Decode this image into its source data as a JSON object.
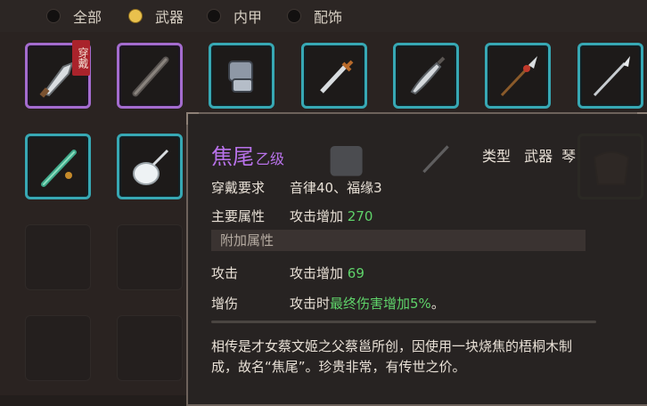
{
  "filters": [
    {
      "label": "全部",
      "selected": false
    },
    {
      "label": "武器",
      "selected": true
    },
    {
      "label": "内甲",
      "selected": false
    },
    {
      "label": "配饰",
      "selected": false
    }
  ],
  "equipped_tag": "穿戴",
  "icons": {
    "row1": [
      "broad-blade-icon",
      "iron-staff-icon",
      "gauntlet-icon",
      "short-sword-icon",
      "saber-icon",
      "tasseled-spear-icon",
      "spear-icon"
    ],
    "row2": [
      "jade-flute-icon",
      "white-brush-icon",
      "fan-icon"
    ]
  },
  "tooltip": {
    "name": "焦尾",
    "grade": "乙级",
    "type_label": "类型",
    "type_value": "武器",
    "type_sub": "琴",
    "requirement_label": "穿戴要求",
    "requirement_value": "音律40、福缘3",
    "main_attr_label": "主要属性",
    "main_attr_text": "攻击增加",
    "main_attr_value": "270",
    "bonus_header": "附加属性",
    "bonus1_label": "攻击",
    "bonus1_text": "攻击增加",
    "bonus1_value": "69",
    "bonus2_label": "增伤",
    "bonus2_prefix": "攻击时",
    "bonus2_highlight": "最终伤害增加5%",
    "bonus2_suffix": "。",
    "description": "相传是才女蔡文姬之父蔡邕所创，因使用一块烧焦的梧桐木制成，故名“焦尾”。珍贵非常，有传世之价。"
  },
  "colors": {
    "rare_purple": "#a46ccf",
    "common_blue": "#37a8b4",
    "uncommon_green": "#7fb85b",
    "highlight_green": "#5fd36a",
    "equipped_red": "#a9232b",
    "radio_selected": "#e9c14d"
  }
}
